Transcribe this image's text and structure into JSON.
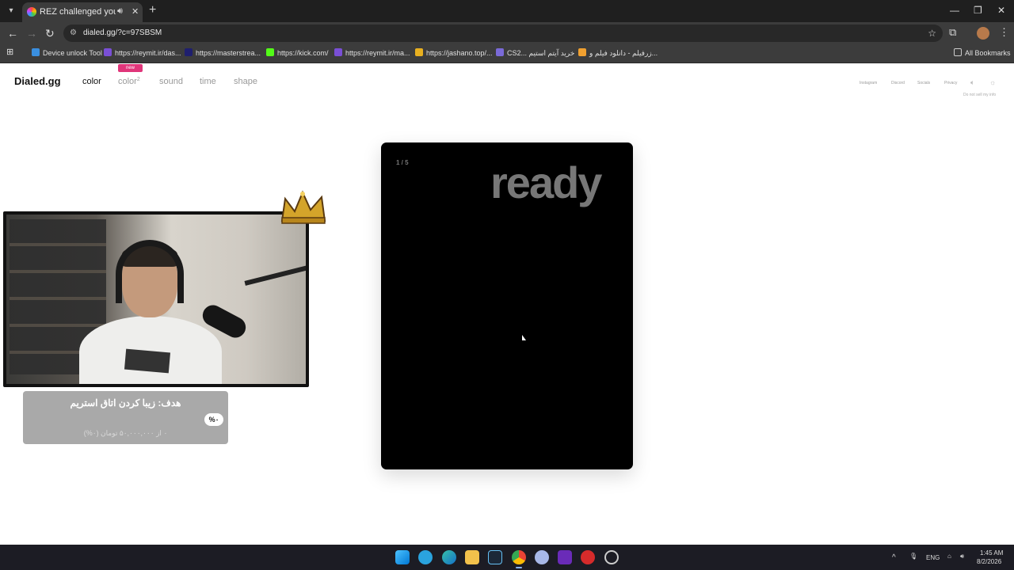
{
  "browser": {
    "tab_title": "REZ challenged you to a co",
    "url": "dialed.gg/?c=97SBSM",
    "bookmarks": [
      {
        "label": "Device unlock Tool",
        "color": "#3a8fe0"
      },
      {
        "label": "https://reymit.ir/das...",
        "color": "#7a4fd6"
      },
      {
        "label": "https://masterstrea...",
        "color": "#1f1f6e"
      },
      {
        "label": "https://kick.com/",
        "color": "#53fc18"
      },
      {
        "label": "https://reymit.ir/ma...",
        "color": "#7a4fd6"
      },
      {
        "label": "https://jashano.top/...",
        "color": "#e8b020"
      },
      {
        "label": "CS2... خرید آیتم استیم",
        "color": "#7a6ad8"
      },
      {
        "label": "زرفیلم - دانلود فیلم و...",
        "color": "#f0a030"
      }
    ],
    "all_bookmarks": "All Bookmarks"
  },
  "site": {
    "logo": "Dialed.gg",
    "nav": {
      "color": "color",
      "color2": "color",
      "color2_sup": "2",
      "new_badge": "new",
      "sound": "sound",
      "time": "time",
      "shape": "shape"
    },
    "footer_links": {
      "instagram": "Instagram",
      "discord": "Discord",
      "socials": "Socials",
      "privacy": "Privacy",
      "do_not_sell": "Do not sell my info"
    }
  },
  "game": {
    "counter": "1 / 5",
    "status": "ready"
  },
  "overlay": {
    "goal_title": "هدف: زیبا کردن اتاق استریم",
    "goal_percent": "%۰",
    "goal_sub": "۰ از ۵۰,۰۰۰,۰۰۰ تومان (۰%)"
  },
  "taskbar": {
    "lang": "ENG",
    "time": "1:45 AM",
    "date": "8/2/2026"
  }
}
